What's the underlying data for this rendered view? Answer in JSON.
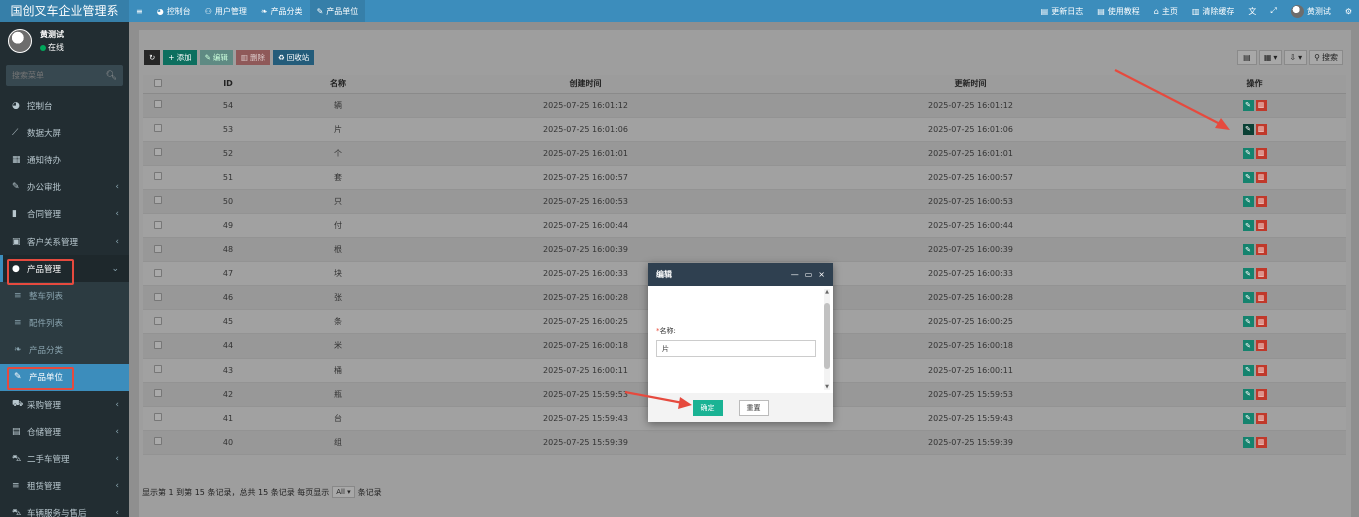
{
  "app": {
    "title": "国创叉车企业管理系"
  },
  "user": {
    "name": "黄测试",
    "status": "在线"
  },
  "sidebar": {
    "search_placeholder": "搜索菜单",
    "items": [
      {
        "label": "控制台",
        "icon": "dashboard-icon"
      },
      {
        "label": "数据大屏",
        "icon": "chart-icon"
      },
      {
        "label": "通知待办",
        "icon": "calendar-icon"
      },
      {
        "label": "办公审批",
        "icon": "wrench-icon"
      },
      {
        "label": "合同管理",
        "icon": "bookmark-icon"
      },
      {
        "label": "客户关系管理",
        "icon": "id-card-icon"
      },
      {
        "label": "产品管理",
        "icon": "circle-icon"
      },
      {
        "label": "整车列表",
        "icon": "list-icon"
      },
      {
        "label": "配件列表",
        "icon": "list-icon"
      },
      {
        "label": "产品分类",
        "icon": "leaf-icon"
      },
      {
        "label": "产品单位",
        "icon": "wrench-icon"
      },
      {
        "label": "采购管理",
        "icon": "cart-icon"
      },
      {
        "label": "仓储管理",
        "icon": "database-icon"
      },
      {
        "label": "二手车管理",
        "icon": "car-icon"
      },
      {
        "label": "租赁管理",
        "icon": "list-icon"
      },
      {
        "label": "车辆服务与售后",
        "icon": "car-icon"
      }
    ]
  },
  "topbar": {
    "left": [
      {
        "label": "控制台"
      },
      {
        "label": "用户管理"
      },
      {
        "label": "产品分类"
      },
      {
        "label": "产品单位"
      }
    ],
    "right": [
      {
        "label": "更新日志"
      },
      {
        "label": "使用教程"
      },
      {
        "label": "主页"
      },
      {
        "label": "清除缓存"
      },
      {
        "label": "黄测试"
      }
    ]
  },
  "toolbar": {
    "add": "添加",
    "edit": "编辑",
    "delete": "删除",
    "recycle": "回收站",
    "search": "搜索"
  },
  "table": {
    "columns": [
      "ID",
      "名称",
      "创建时间",
      "更新时间",
      "操作"
    ],
    "rows": [
      {
        "id": "54",
        "name": "辆",
        "created": "2025-07-25 16:01:12",
        "updated": "2025-07-25 16:01:12"
      },
      {
        "id": "53",
        "name": "片",
        "created": "2025-07-25 16:01:06",
        "updated": "2025-07-25 16:01:06"
      },
      {
        "id": "52",
        "name": "个",
        "created": "2025-07-25 16:01:01",
        "updated": "2025-07-25 16:01:01"
      },
      {
        "id": "51",
        "name": "套",
        "created": "2025-07-25 16:00:57",
        "updated": "2025-07-25 16:00:57"
      },
      {
        "id": "50",
        "name": "只",
        "created": "2025-07-25 16:00:53",
        "updated": "2025-07-25 16:00:53"
      },
      {
        "id": "49",
        "name": "付",
        "created": "2025-07-25 16:00:44",
        "updated": "2025-07-25 16:00:44"
      },
      {
        "id": "48",
        "name": "根",
        "created": "2025-07-25 16:00:39",
        "updated": "2025-07-25 16:00:39"
      },
      {
        "id": "47",
        "name": "块",
        "created": "2025-07-25 16:00:33",
        "updated": "2025-07-25 16:00:33"
      },
      {
        "id": "46",
        "name": "张",
        "created": "2025-07-25 16:00:28",
        "updated": "2025-07-25 16:00:28"
      },
      {
        "id": "45",
        "name": "条",
        "created": "2025-07-25 16:00:25",
        "updated": "2025-07-25 16:00:25"
      },
      {
        "id": "44",
        "name": "米",
        "created": "2025-07-25 16:00:18",
        "updated": "2025-07-25 16:00:18"
      },
      {
        "id": "43",
        "name": "桶",
        "created": "2025-07-25 16:00:11",
        "updated": "2025-07-25 16:00:11"
      },
      {
        "id": "42",
        "name": "瓶",
        "created": "2025-07-25 15:59:53",
        "updated": "2025-07-25 15:59:53"
      },
      {
        "id": "41",
        "name": "台",
        "created": "2025-07-25 15:59:43",
        "updated": "2025-07-25 15:59:43"
      },
      {
        "id": "40",
        "name": "组",
        "created": "2025-07-25 15:59:39",
        "updated": "2025-07-25 15:59:39"
      }
    ]
  },
  "pagination": {
    "prefix": "显示第 1 到第 15 条记录，总共 15 条记录 每页显示",
    "page_size": "All",
    "suffix": "条记录"
  },
  "modal": {
    "title": "编辑",
    "field_label": "名称:",
    "field_value": "片",
    "confirm": "确定",
    "reset": "重置"
  },
  "colors": {
    "sidebar_bg": "#222d32",
    "topbar_bg": "#3c8dbc",
    "active_menu": "#3c8dbc",
    "edit_button": "#15836e",
    "delete_button": "#c0392b",
    "annotation_red": "#e64a3e",
    "confirm_button": "#1ab394"
  }
}
